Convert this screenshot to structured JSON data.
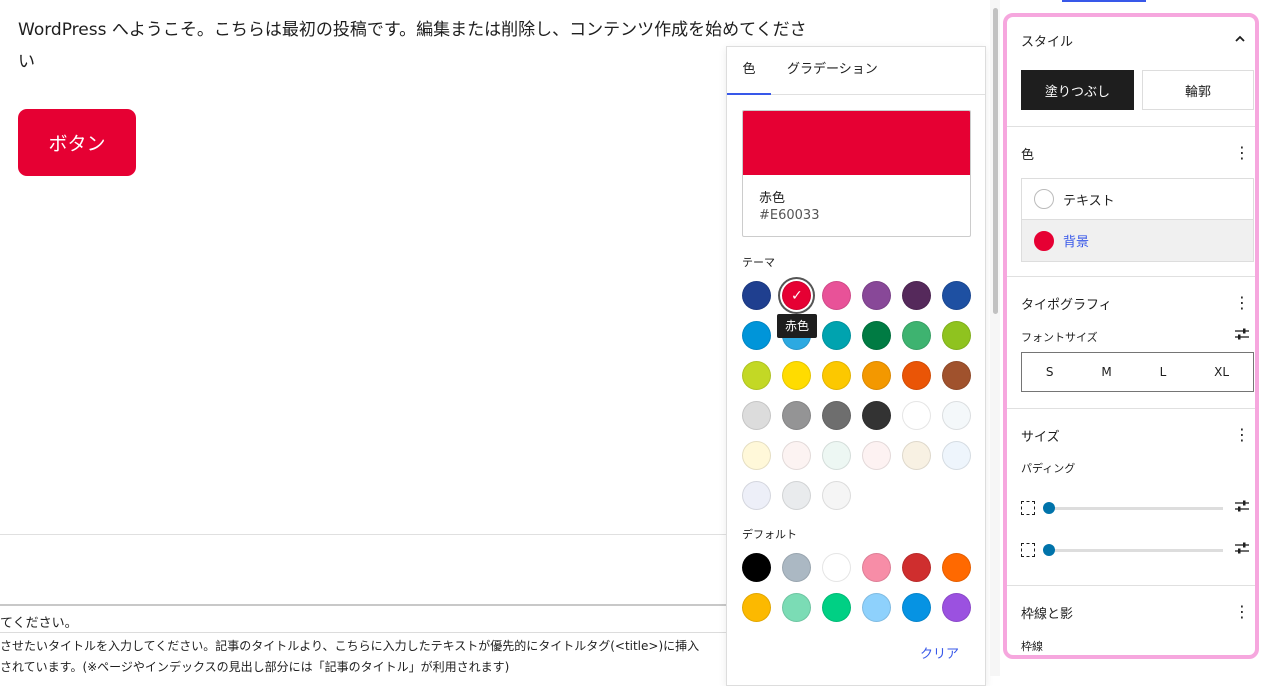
{
  "canvas": {
    "post_text": "WordPress へようこそ。こちらは最初の投稿です。編集または削除し、コンテンツ作成を始めてください",
    "button_label": "ボタン",
    "meta_line1": "てください。",
    "meta_line2": "させたいタイトルを入力してください。記事のタイトルより、こちらに入力したテキストが優先的にタイトルタグ(<title>)に挿入",
    "meta_line3": "されています。(※ページやインデックスの見出し部分には「記事のタイトル」が利用されます)"
  },
  "color_popover": {
    "tabs": [
      "色",
      "グラデーション"
    ],
    "selected_name": "赤色",
    "selected_hex": "#E60033",
    "selected_color": "#e60033",
    "theme_label": "テーマ",
    "tooltip": "赤色",
    "default_label": "デフォルト",
    "clear_label": "クリア",
    "theme_colors": [
      "#1f3f8f",
      "#e60033",
      "#e85298",
      "#884898",
      "#55295b",
      "#1e50a2",
      "#0095d9",
      "#2ca9e1",
      "#00a3af",
      "#007b43",
      "#3eb370",
      "#8fc31f",
      "#c3d825",
      "#ffdc00",
      "#fcc800",
      "#f39800",
      "#ea5506",
      "#a0522d",
      "#dcdcdc",
      "#949495",
      "#6e6e6e",
      "#333333",
      "#ffffff",
      "#f4f8fa",
      "#fff8d9",
      "#fcf3f2",
      "#edf7f3",
      "#fdf2f2",
      "#f8f1e3",
      "#eef5fc",
      "#edeff8",
      "#e9ebed",
      "#f5f5f5"
    ],
    "default_colors": [
      "#000000",
      "#abb8c3",
      "#ffffff",
      "#f78da7",
      "#cf2e2e",
      "#ff6900",
      "#fcb900",
      "#7bdcb5",
      "#00d084",
      "#8ed1fc",
      "#0693e3",
      "#9b51e0"
    ]
  },
  "sidebar": {
    "style_title": "スタイル",
    "style_fill": "塗りつぶし",
    "style_outline": "輪郭",
    "color_title": "色",
    "color_text": "テキスト",
    "color_background": "背景",
    "color_background_swatch": "#e60033",
    "typography_title": "タイポグラフィ",
    "font_size_label": "フォントサイズ",
    "font_sizes": [
      "S",
      "M",
      "L",
      "XL"
    ],
    "dimensions_title": "サイズ",
    "padding_label": "パディング",
    "border_title": "枠線と影",
    "border_label": "枠線"
  }
}
